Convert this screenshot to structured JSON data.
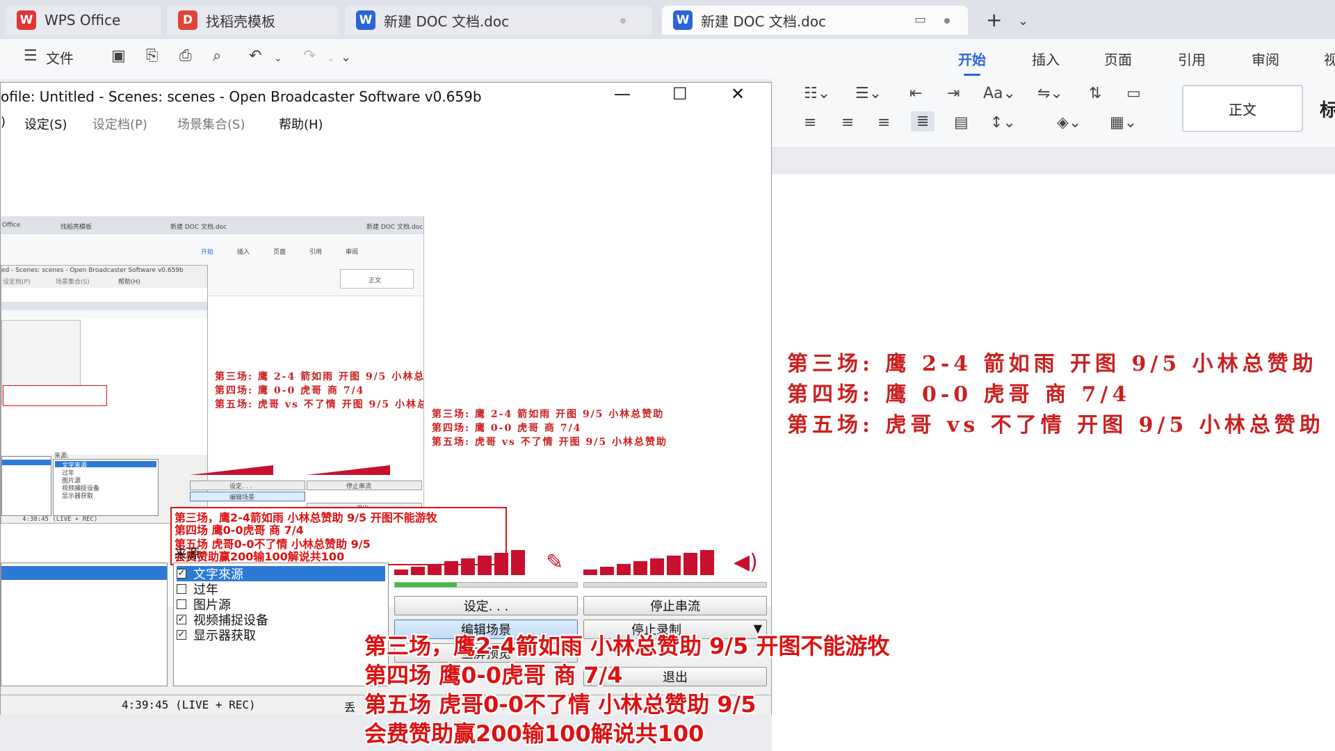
{
  "wps": {
    "tabs": [
      {
        "label": "WPS Office",
        "icon": "wps-logo-icon"
      },
      {
        "label": "找稻壳模板",
        "icon": "docer-icon"
      },
      {
        "label": "新建 DOC 文档.doc",
        "icon": "word-doc-icon"
      },
      {
        "label": "新建 DOC 文档.doc",
        "icon": "word-doc-icon"
      }
    ],
    "toolbar": {
      "menu_label": "文件",
      "ribbon_tabs": [
        "开始",
        "插入",
        "页面",
        "引用",
        "审阅",
        "视"
      ]
    },
    "style_box": "正文",
    "style_next": "标",
    "accent_color": "#2a66e0"
  },
  "document": {
    "lines": [
      "第三场: 鹰 2-4 箭如雨  开图 9/5  小林总赞助",
      "第四场: 鹰 0-0 虎哥  商 7/4",
      "第五场: 虎哥 vs 不了情  开图 9/5  小林总赞助"
    ],
    "text_color": "#cc1f1f"
  },
  "obs": {
    "title": "ofile: Untitled - Scenes: scenes - Open Broadcaster Software v0.659b",
    "menu": [
      "设定(S)",
      "设定档(P)",
      "场景集合(S)",
      "帮助(H)"
    ],
    "sources_label": "来源:",
    "sources": [
      {
        "label": "文字來源",
        "checked": true,
        "selected": true
      },
      {
        "label": "过年",
        "checked": false,
        "selected": false
      },
      {
        "label": "图片源",
        "checked": false,
        "selected": false
      },
      {
        "label": "视频捕捉设备",
        "checked": true,
        "selected": false
      },
      {
        "label": "显示器获取",
        "checked": true,
        "selected": false
      }
    ],
    "buttons": {
      "settings": "设定. . .",
      "stop_stream": "停止串流",
      "edit_scene": "编辑场景",
      "stop_record": "停止录制",
      "fullscreen": "全屏预览",
      "exit": "退出"
    },
    "status_time": "4:39:45 (LIVE + REC)",
    "status_drop": "丢"
  },
  "overlay_text": [
    "第三场，鹰2-4箭如雨 小林总赞助 9/5 开图不能游牧",
    "第四场 鹰0-0虎哥 商 7/4",
    "第五场 虎哥0-0不了情 小林总赞助 9/5",
    "会费赞助赢200输100解说共100"
  ],
  "nested_preview": {
    "tabs": [
      "Office",
      "找稻壳模板",
      "新建 DOC 文档.doc",
      "新建 DOC 文档.doc"
    ],
    "title": "ed - Scenes: scenes - Open Broadcaster Software v0.659b",
    "ribbon_tabs": [
      "开始",
      "插入",
      "页面",
      "引用",
      "审阅"
    ],
    "menu": [
      "设定档(P)",
      "场景集合(S)",
      "帮助(H)"
    ],
    "style_box": "正文",
    "sources_label": "来源:",
    "sources": [
      "文字来源",
      "过年",
      "图片源",
      "视频捕捉设备",
      "显示器获取"
    ],
    "btn_settings": "设定. . .",
    "btn_stop_stream": "停止串流",
    "btn_edit": "编辑场景",
    "btn_exit": "退出",
    "status": "4:38:45 (LIVE + REC)"
  }
}
